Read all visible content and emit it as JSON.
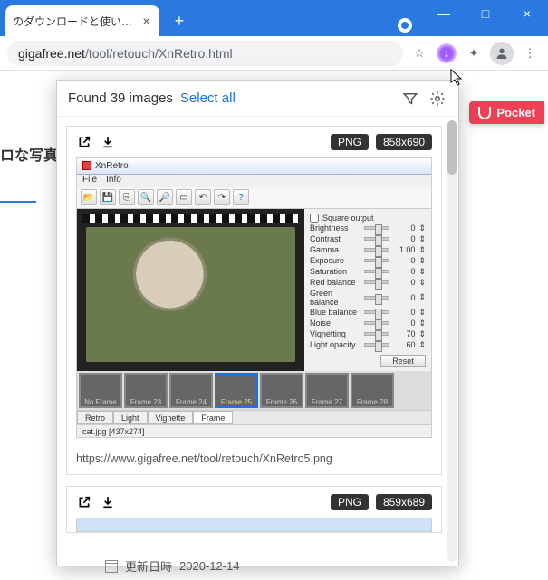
{
  "window": {
    "tab_title": "のダウンロードと使い方 - k",
    "url_display_prefix": "gigafree.net",
    "url_display_suffix": "/tool/retouch/XnRetro.html"
  },
  "page": {
    "jp_fragment": "ロな写真",
    "date_label": "更新日時",
    "date_value": "2020-12-14"
  },
  "pocket": {
    "label": "Pocket"
  },
  "popup": {
    "found_text": "Found 39 images",
    "select_all": "Select all",
    "cards": [
      {
        "format": "PNG",
        "dimensions": "858x690",
        "caption_url": "https://www.gigafree.net/tool/retouch/XnRetro5.png"
      },
      {
        "format": "PNG",
        "dimensions": "859x689",
        "caption_url": ""
      }
    ]
  },
  "xn": {
    "title": "XnRetro",
    "menu": [
      "File",
      "Info"
    ],
    "sliders": [
      {
        "label": "Brightness",
        "val": "0"
      },
      {
        "label": "Contrast",
        "val": "0"
      },
      {
        "label": "Gamma",
        "val": "1.00"
      },
      {
        "label": "Exposure",
        "val": "0"
      },
      {
        "label": "Saturation",
        "val": "0"
      },
      {
        "label": "Red balance",
        "val": "0"
      },
      {
        "label": "Green balance",
        "val": "0"
      },
      {
        "label": "Blue balance",
        "val": "0"
      },
      {
        "label": "Noise",
        "val": "0"
      },
      {
        "label": "Vignetting",
        "val": "70"
      },
      {
        "label": "Light opacity",
        "val": "60"
      }
    ],
    "square_output": "Square output",
    "reset": "Reset",
    "frames": [
      "No Frame",
      "Frame 23",
      "Frame 24",
      "Frame 25",
      "Frame 26",
      "Frame 27",
      "Frame 28"
    ],
    "selected_frame_index": 3,
    "tabs": [
      "Retro",
      "Light",
      "Vignette",
      "Frame"
    ],
    "active_tab_index": 3,
    "status": "cat.jpg [437x274]"
  }
}
